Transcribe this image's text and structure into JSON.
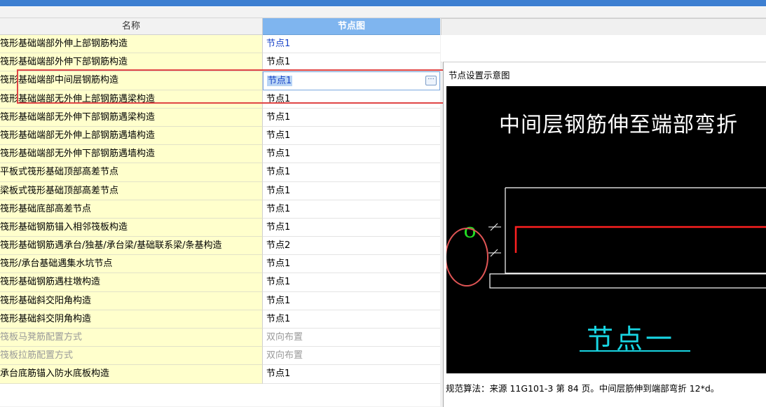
{
  "grid": {
    "header_name": "名称",
    "header_node": "节点图",
    "rows": [
      {
        "name": "筏形基础端部外伸上部钢筋构造",
        "node": "节点1",
        "style": "link"
      },
      {
        "name": "筏形基础端部外伸下部钢筋构造",
        "node": "节点1",
        "style": "normal"
      },
      {
        "name": "筏形基础端部中间层钢筋构造",
        "node": "节点1",
        "style": "editing"
      },
      {
        "name": "筏形基础端部无外伸上部钢筋遇梁构造",
        "node": "节点1",
        "style": "normal"
      },
      {
        "name": "筏形基础端部无外伸下部钢筋遇梁构造",
        "node": "节点1",
        "style": "normal"
      },
      {
        "name": "筏形基础端部无外伸上部钢筋遇墙构造",
        "node": "节点1",
        "style": "normal"
      },
      {
        "name": "筏形基础端部无外伸下部钢筋遇墙构造",
        "node": "节点1",
        "style": "normal"
      },
      {
        "name": "平板式筏形基础顶部高差节点",
        "node": "节点1",
        "style": "normal"
      },
      {
        "name": "梁板式筏形基础顶部高差节点",
        "node": "节点1",
        "style": "normal"
      },
      {
        "name": "筏形基础底部高差节点",
        "node": "节点1",
        "style": "normal"
      },
      {
        "name": "筏形基础钢筋锚入相邻筏板构造",
        "node": "节点1",
        "style": "normal"
      },
      {
        "name": "筏形基础钢筋遇承台/独基/承台梁/基础联系梁/条基构造",
        "node": "节点2",
        "style": "normal"
      },
      {
        "name": "筏形/承台基础遇集水坑节点",
        "node": "节点1",
        "style": "normal"
      },
      {
        "name": "筏形基础钢筋遇柱墩构造",
        "node": "节点1",
        "style": "normal"
      },
      {
        "name": "筏形基础斜交阳角构造",
        "node": "节点1",
        "style": "normal"
      },
      {
        "name": "筏形基础斜交阴角构造",
        "node": "节点1",
        "style": "normal"
      },
      {
        "name": "筏板马凳筋配置方式",
        "node": "双向布置",
        "style": "gray"
      },
      {
        "name": "筏板拉筋配置方式",
        "node": "双向布置",
        "style": "gray"
      },
      {
        "name": "承台底筋锚入防水底板构造",
        "node": "节点1",
        "style": "normal"
      }
    ],
    "ellipsis_label": "···"
  },
  "diagram": {
    "panel_title": "节点设置示意图",
    "heading": "中间层钢筋伸至端部弯折",
    "node_label": "节点一",
    "dimension_mark": "0",
    "footnote": "规范算法：来源 11G101-3 第 84 页。中间层筋伸到端部弯折 12*d。"
  },
  "colors": {
    "titlebar": "#3d7fd1",
    "header_node_bg": "#7fb5ef",
    "name_cell_bg": "#ffffcc",
    "link_text": "#1a44c8",
    "highlight": "#e04545",
    "canvas_bg": "#000000",
    "rebar_red": "#ff2020",
    "dim_green": "#22dd22",
    "node_label_cyan": "#18d5e2"
  }
}
